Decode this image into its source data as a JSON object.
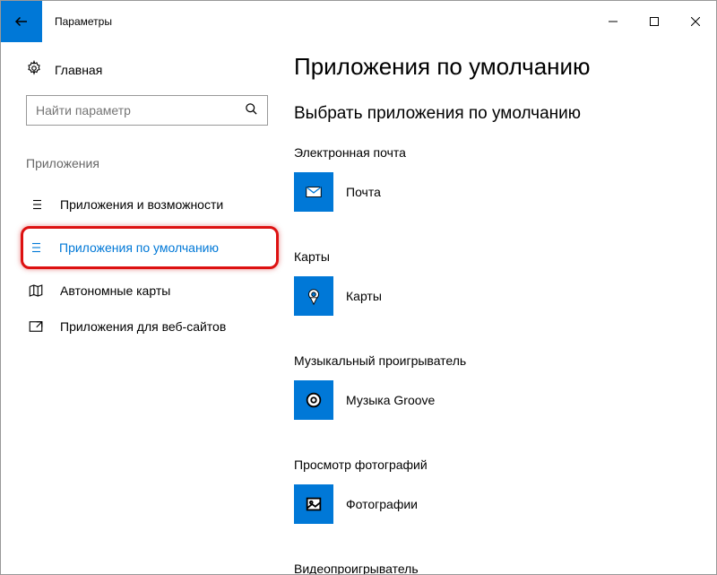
{
  "titlebar": {
    "title": "Параметры"
  },
  "sidebar": {
    "home": "Главная",
    "search_placeholder": "Найти параметр",
    "section": "Приложения",
    "items": [
      {
        "label": "Приложения и возможности"
      },
      {
        "label": "Приложения по умолчанию"
      },
      {
        "label": "Автономные карты"
      },
      {
        "label": "Приложения для веб-сайтов"
      }
    ]
  },
  "main": {
    "heading": "Приложения по умолчанию",
    "subheading": "Выбрать приложения по умолчанию",
    "categories": [
      {
        "title": "Электронная почта",
        "app": "Почта"
      },
      {
        "title": "Карты",
        "app": "Карты"
      },
      {
        "title": "Музыкальный проигрыватель",
        "app": "Музыка Groove"
      },
      {
        "title": "Просмотр фотографий",
        "app": "Фотографии"
      },
      {
        "title": "Видеопроигрыватель",
        "app": ""
      }
    ]
  }
}
